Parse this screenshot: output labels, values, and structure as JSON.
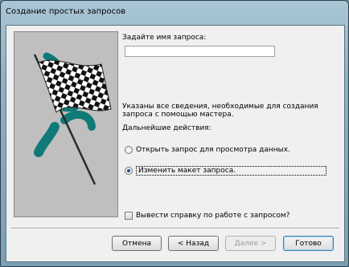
{
  "window": {
    "title": "Создание простых запросов"
  },
  "form": {
    "name_label": "Задайте имя запроса:",
    "name_value": "",
    "info_text": "Указаны все сведения, необходимые для создания запроса с помощью мастера.",
    "next_actions_label": "Дальнейшие действия:",
    "options": [
      {
        "label": "Открыть запрос для просмотра данных.",
        "checked": false
      },
      {
        "label": "Изменить макет запроса.",
        "checked": true
      }
    ],
    "help_checkbox_label": "Вывести справку по работе с запросом?",
    "help_checked": false
  },
  "buttons": {
    "cancel": "Отмена",
    "back": "< Назад",
    "next": "Далее >",
    "finish": "Готово"
  },
  "colors": {
    "panel_bg": "#bfbfbf",
    "teal_accent": "#0f7a78",
    "dialog_bg": "#f0f0f0"
  }
}
